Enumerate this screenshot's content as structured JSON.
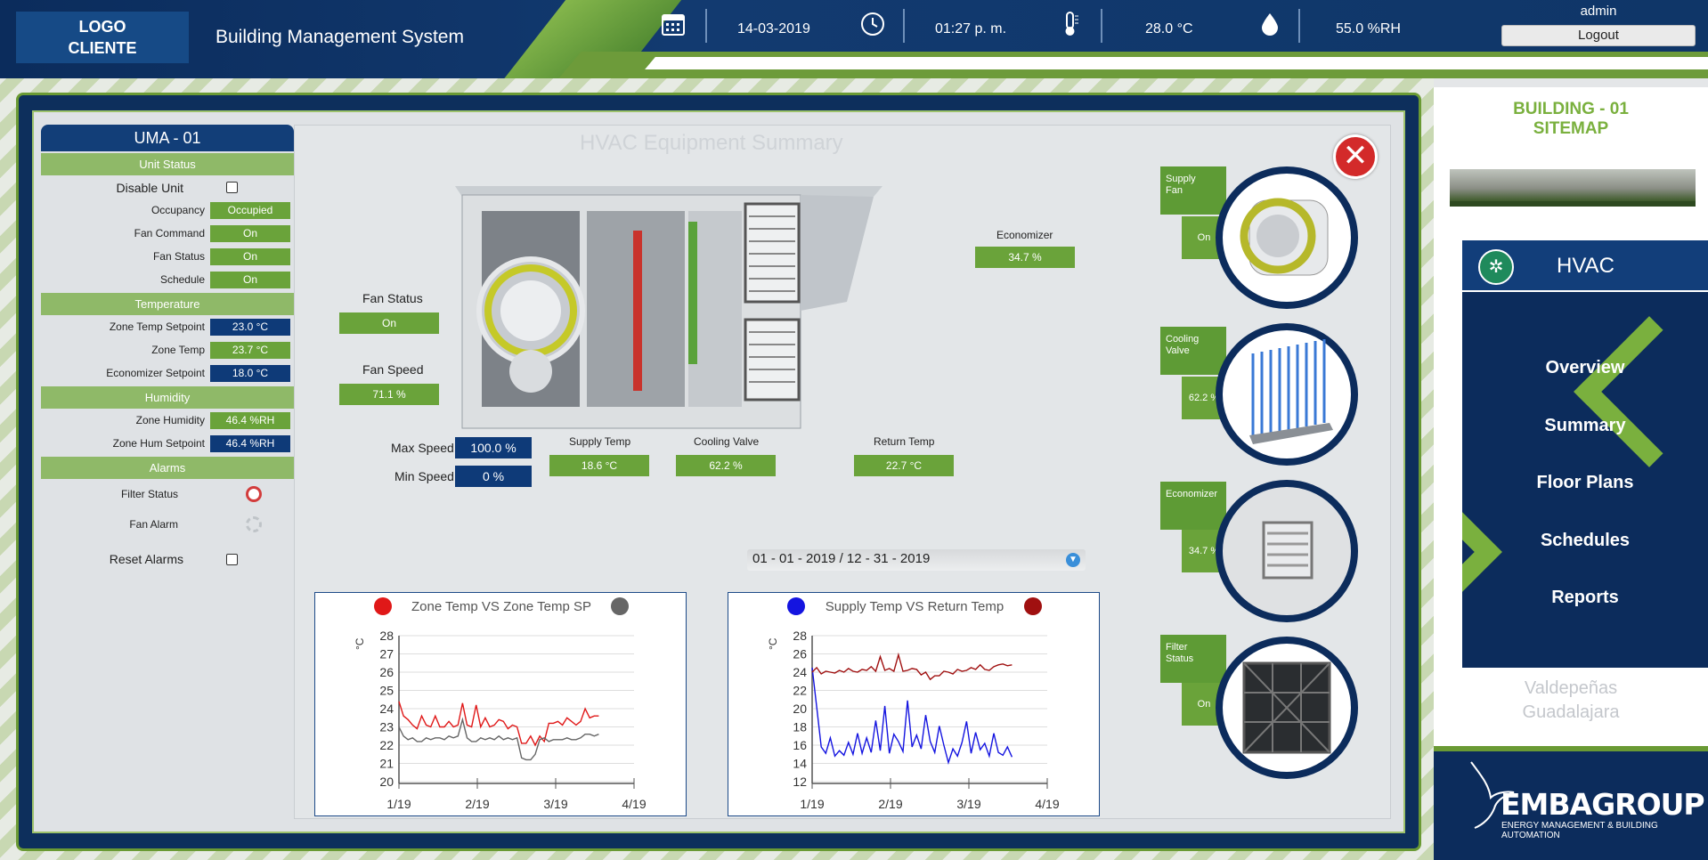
{
  "header": {
    "logo": "LOGO\nCLIENTE",
    "title": "Building Management System",
    "date": "14-03-2019",
    "time": "01:27 p. m.",
    "temperature": "28.0 °C",
    "humidity": "55.0 %RH",
    "user": "admin",
    "logout": "Logout",
    "icons": [
      "calendar-icon",
      "clock-icon",
      "thermometer-icon",
      "droplet-icon"
    ]
  },
  "left": {
    "unit_name": "UMA - 01",
    "unit_status": {
      "title": "Unit Status",
      "disable_unit": "Disable Unit",
      "occupancy": {
        "label": "Occupancy",
        "value": "Occupied"
      },
      "fan_command": {
        "label": "Fan Command",
        "value": "On"
      },
      "fan_status": {
        "label": "Fan Status",
        "value": "On"
      },
      "schedule": {
        "label": "Schedule",
        "value": "On"
      }
    },
    "temperature": {
      "title": "Temperature",
      "zone_temp_sp": {
        "label": "Zone Temp Setpoint",
        "value": "23.0 °C"
      },
      "zone_temp": {
        "label": "Zone Temp",
        "value": "23.7 °C"
      },
      "econ_sp": {
        "label": "Economizer Setpoint",
        "value": "18.0 °C"
      }
    },
    "humidity": {
      "title": "Humidity",
      "zone_humidity": {
        "label": "Zone Humidity",
        "value": "46.4 %RH"
      },
      "zone_hum_sp": {
        "label": "Zone Hum Setpoint",
        "value": "46.4 %RH"
      }
    },
    "alarms": {
      "title": "Alarms",
      "filter_status": "Filter Status",
      "fan_alarm": "Fan Alarm",
      "reset": "Reset Alarms"
    }
  },
  "main": {
    "ghost_title": "HVAC Equipment Summary",
    "fan_status_label": "Fan Status",
    "fan_status_value": "On",
    "fan_speed_label": "Fan Speed",
    "fan_speed_value": "71.1 %",
    "economizer_label": "Economizer",
    "economizer_value": "34.7 %",
    "max_speed_label": "Max Speed",
    "max_speed_value": "100.0 %",
    "min_speed_label": "Min Speed",
    "min_speed_value": "0 %",
    "supply_temp_label": "Supply Temp",
    "supply_temp_value": "18.6 °C",
    "cooling_valve_label": "Cooling Valve",
    "cooling_valve_value": "62.2 %",
    "return_temp_label": "Return Temp",
    "return_temp_value": "22.7 °C",
    "date_range": "01 - 01 - 2019 / 12 - 31 - 2019",
    "side": [
      {
        "label": "Supply\nFan",
        "value": "On"
      },
      {
        "label": "Cooling\nValve",
        "value": "62.2 %"
      },
      {
        "label": "Economizer",
        "value": "34.7 %"
      },
      {
        "label": "Filter\nStatus",
        "value": "On"
      }
    ]
  },
  "chart_data": [
    {
      "type": "line",
      "title": "Zone Temp VS Zone Temp SP",
      "ylabel": "°C",
      "ylim": [
        20,
        28
      ],
      "yticks": [
        20,
        21,
        22,
        23,
        24,
        25,
        26,
        27,
        28
      ],
      "xticks": [
        "1/19",
        "2/19",
        "3/19",
        "4/19"
      ],
      "series": [
        {
          "color": "#e01818",
          "values": [
            24.4,
            23.6,
            23.4,
            23.1,
            22.9,
            23.6,
            23.1,
            23.0,
            23.6,
            23.0,
            23.0,
            23.3,
            23.0,
            23.1,
            24.3,
            23.1,
            23.0,
            24.2,
            23.0,
            23.5,
            23.0,
            23.1,
            23.4,
            23.3,
            22.9,
            23.1,
            23.0,
            22.1,
            22.1,
            22.5,
            22.0,
            22.5,
            22.2,
            23.2,
            23.2,
            23.3,
            23.1,
            23.5,
            23.3,
            23.1,
            23.3,
            24.0,
            23.5,
            23.6,
            23.6
          ]
        },
        {
          "color": "#666666",
          "values": [
            23.0,
            22.5,
            22.3,
            22.4,
            22.2,
            22.2,
            22.4,
            22.3,
            22.4,
            22.4,
            22.3,
            22.5,
            22.4,
            22.5,
            23.4,
            22.4,
            22.2,
            22.2,
            22.4,
            22.3,
            22.4,
            22.3,
            22.5,
            22.3,
            22.4,
            22.3,
            22.4,
            21.3,
            21.2,
            21.2,
            21.5,
            22.3,
            22.4,
            22.2,
            22.3,
            22.3,
            22.3,
            22.4,
            22.3,
            22.3,
            22.4,
            22.6,
            22.6,
            22.5,
            22.6
          ]
        }
      ]
    },
    {
      "type": "line",
      "title": "Supply Temp VS Return Temp",
      "ylabel": "°C",
      "ylim": [
        12,
        28
      ],
      "yticks": [
        12,
        14,
        16,
        18,
        20,
        22,
        24,
        26,
        28
      ],
      "xticks": [
        "1/19",
        "2/19",
        "3/19",
        "4/19"
      ],
      "series": [
        {
          "color": "#1414e0",
          "values": [
            24.5,
            20.2,
            15.8,
            15.1,
            16.8,
            14.8,
            15.4,
            14.9,
            16.3,
            15.0,
            17.3,
            15.1,
            16.8,
            15.2,
            18.7,
            15.4,
            20.3,
            15.1,
            17.2,
            16.4,
            15.3,
            20.9,
            15.8,
            17.1,
            15.6,
            19.3,
            16.4,
            15.2,
            18.1,
            16.0,
            14.1,
            15.6,
            14.8,
            16.3,
            18.6,
            15.1,
            17.4,
            15.5,
            16.2,
            14.8,
            17.3,
            15.2,
            14.9,
            15.8,
            14.7
          ]
        },
        {
          "color": "#a01010",
          "values": [
            24.0,
            24.5,
            23.8,
            24.1,
            24.0,
            23.9,
            24.2,
            24.0,
            24.4,
            24.1,
            24.0,
            24.3,
            24.2,
            24.6,
            24.1,
            25.7,
            24.2,
            24.4,
            24.1,
            25.9,
            24.1,
            24.2,
            24.4,
            24.3,
            23.7,
            24.0,
            23.2,
            23.6,
            23.6,
            24.1,
            24.0,
            23.8,
            24.3,
            24.1,
            24.2,
            24.5,
            24.3,
            24.8,
            24.3,
            24.2,
            24.6,
            24.8,
            24.9,
            24.7,
            24.8
          ]
        }
      ]
    }
  ],
  "right": {
    "sitemap": "BUILDING - 01\nSITEMAP",
    "hvac": "HVAC",
    "nav": [
      "Overview",
      "Summary",
      "Floor Plans",
      "Schedules",
      "Reports"
    ],
    "location": "Valdepeñas\nGuadalajara",
    "brand": "EMBAGROUP",
    "tagline": "ENERGY MANAGEMENT & BUILDING AUTOMATION"
  }
}
